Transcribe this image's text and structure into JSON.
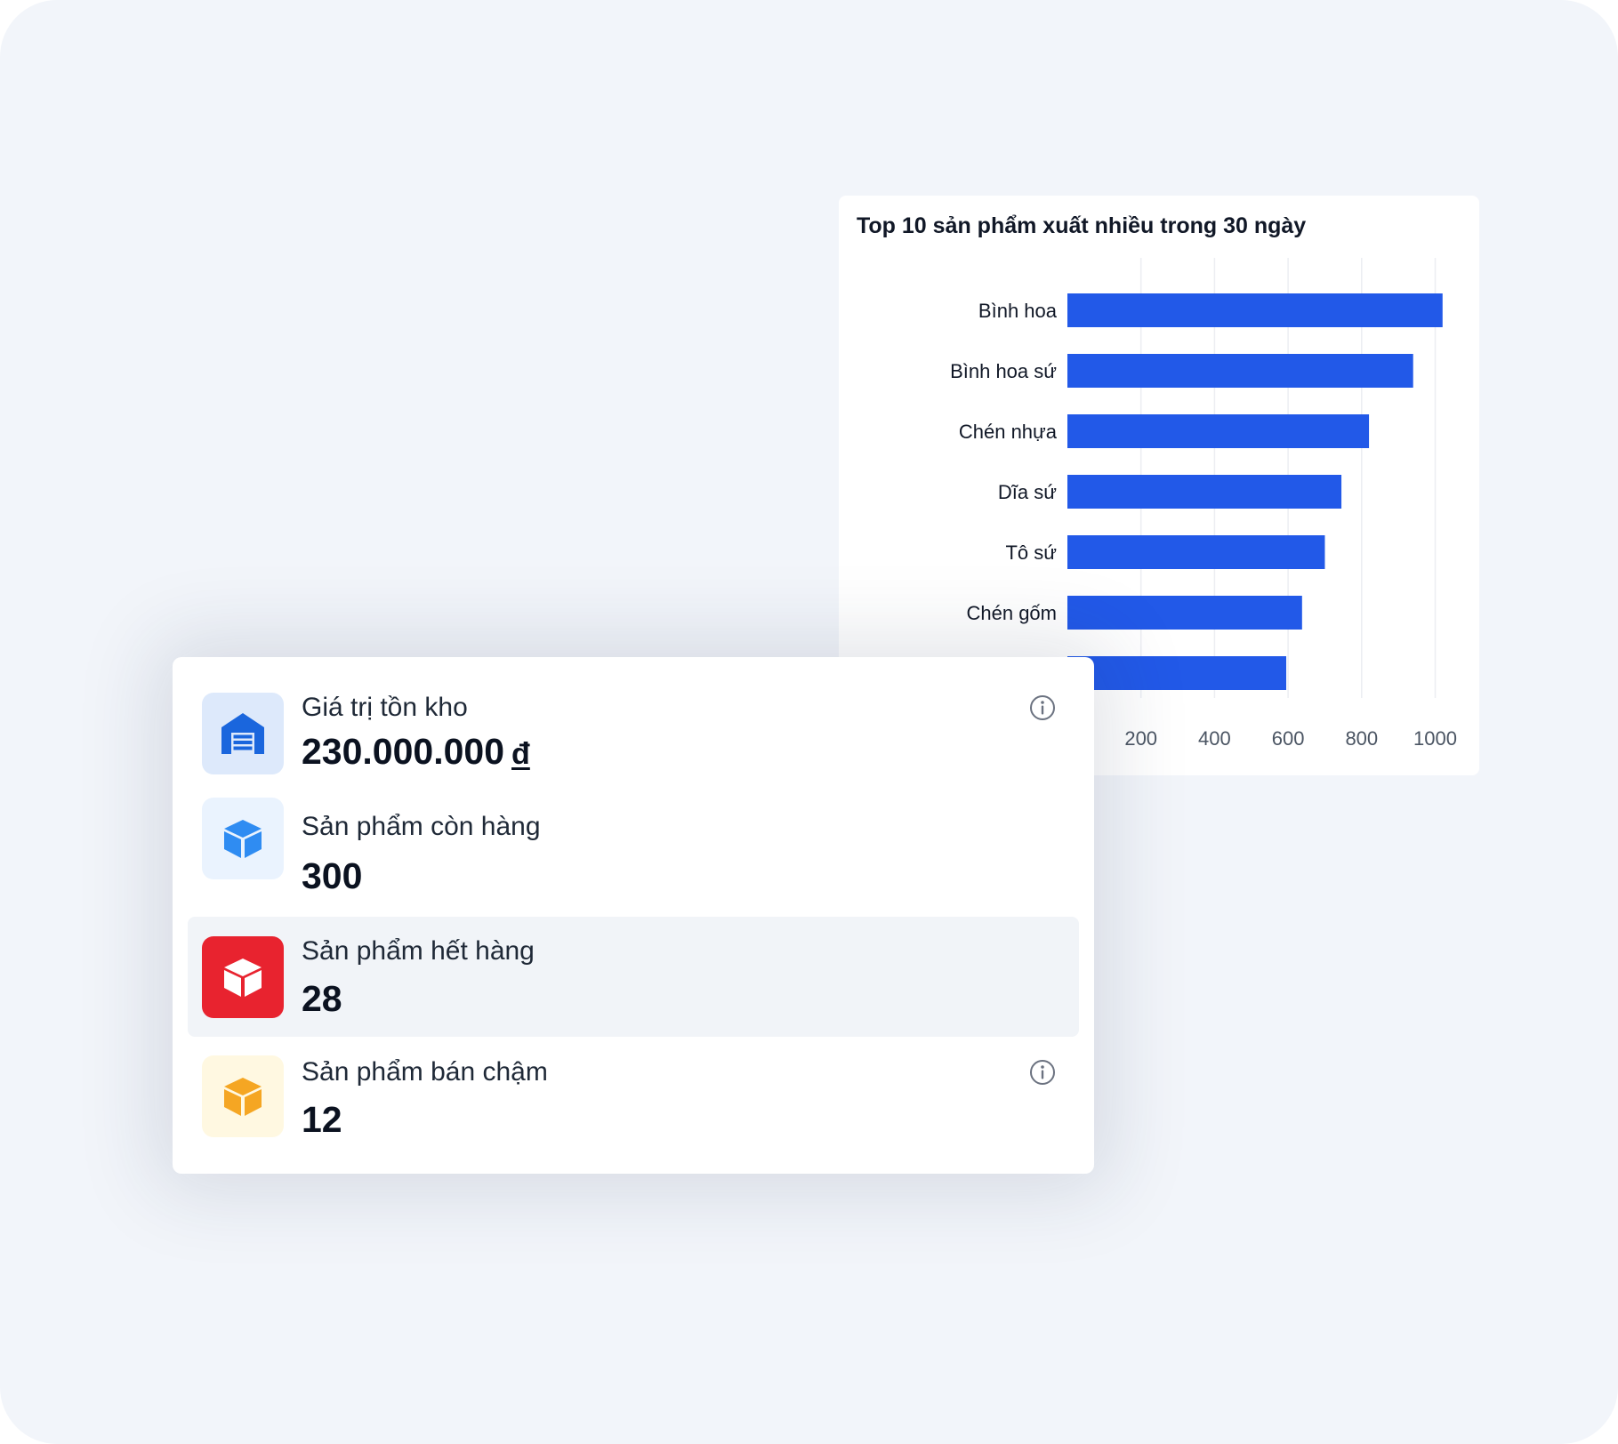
{
  "chart": {
    "title": "Top 10 sản phẩm xuất nhiều trong 30 ngày"
  },
  "chart_data": {
    "type": "bar",
    "orientation": "horizontal",
    "title": "Top 10 sản phẩm xuất nhiều trong 30 ngày",
    "categories": [
      "Bình hoa",
      "Bình hoa sứ",
      "Chén nhựa",
      "Dĩa sứ",
      "Tô sứ",
      "Chén gốm",
      ""
    ],
    "values": [
      1020,
      940,
      820,
      745,
      700,
      638,
      595
    ],
    "xlim": [
      0,
      1000
    ],
    "xticks": [
      200,
      400,
      600,
      800,
      1000
    ],
    "grid": true,
    "color": "#2259e8"
  },
  "stats": [
    {
      "label": "Giá trị tồn kho",
      "value": "230.000.000",
      "currency": "đ",
      "icon": "warehouse-icon",
      "icon_color": "#1a66dd",
      "icon_bg": "#dde9fb",
      "info": true
    },
    {
      "label": "Sản phẩm còn hàng",
      "value": "300",
      "icon": "box-icon",
      "icon_color": "#2f8cf2",
      "icon_bg": "#eaf3fe",
      "info": false
    },
    {
      "label": "Sản phẩm hết hàng",
      "value": "28",
      "icon": "box-icon",
      "icon_color": "#ffffff",
      "icon_bg": "#e8232f",
      "info": false,
      "highlighted": true
    },
    {
      "label": "Sản phẩm bán chậm",
      "value": "12",
      "icon": "box-icon",
      "icon_color": "#f5a623",
      "icon_bg": "#fff8e1",
      "info": true
    }
  ]
}
